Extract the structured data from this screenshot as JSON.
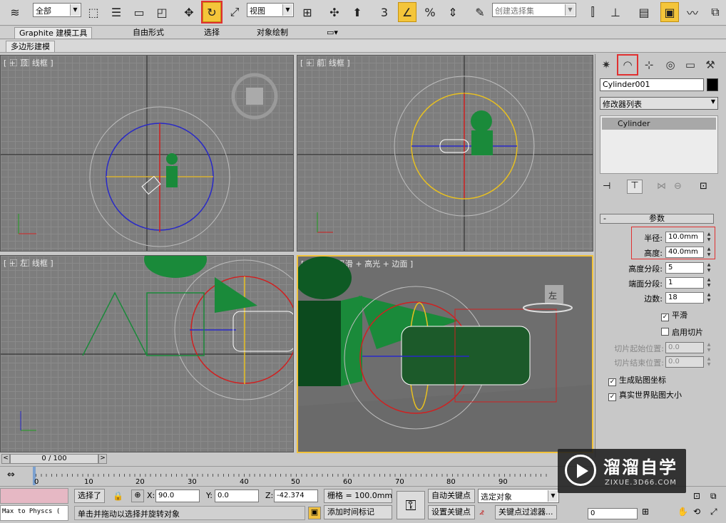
{
  "toolbar": {
    "selection_filter": "全部",
    "ref_coord": "视图",
    "named_selection_placeholder": "创建选择集",
    "snap_label": "3"
  },
  "ribbon": {
    "tabs": [
      "Graphite 建模工具",
      "自由形式",
      "选择",
      "对象绘制"
    ],
    "sub_tab": "多边形建模"
  },
  "viewports": {
    "top": {
      "label": "[ + ⃞ 顶 ⃞ 线框 ]"
    },
    "front": {
      "label": "[ + ⃞ 前 ⃞ 线框 ]"
    },
    "left": {
      "label": "[ + ⃞ 左 ⃞ 线框 ]"
    },
    "persp": {
      "label": "[ + ⃞ 透视 ⃞ 平滑 + 高光 + 边面 ]",
      "viewcube": "左"
    }
  },
  "command_panel": {
    "object_name": "Cylinder001",
    "modifier_list": "修改器列表",
    "stack_item": "Cylinder",
    "rollout_title": "参数",
    "params": [
      {
        "label": "半径:",
        "value": "10.0mm",
        "disabled": false
      },
      {
        "label": "高度:",
        "value": "40.0mm",
        "disabled": false
      },
      {
        "label": "高度分段:",
        "value": "5",
        "disabled": false
      },
      {
        "label": "端面分段:",
        "value": "1",
        "disabled": false
      },
      {
        "label": "边数:",
        "value": "18",
        "disabled": false
      }
    ],
    "smooth_label": "平滑",
    "smooth_checked": true,
    "slice_on_label": "启用切片",
    "slice_on_checked": false,
    "slice_from": {
      "label": "切片起始位置:",
      "value": "0.0"
    },
    "slice_to": {
      "label": "切片结束位置:",
      "value": "0.0"
    },
    "gen_map_label": "生成贴图坐标",
    "gen_map_checked": true,
    "real_world_label": "真实世界贴图大小",
    "real_world_checked": true
  },
  "timeline": {
    "frame_label": "0 / 100",
    "ticks": [
      "0",
      "10",
      "20",
      "30",
      "40",
      "50",
      "60",
      "70",
      "80",
      "90"
    ]
  },
  "status": {
    "maxscript": "Max to Physcs (",
    "selected": "选择了",
    "x_label": "X:",
    "x_value": "90.0",
    "y_label": "Y:",
    "y_value": "0.0",
    "z_label": "Z:",
    "z_value": "-42.374",
    "grid": "栅格 = 100.0mm",
    "auto_key": "自动关键点",
    "set_key": "设置关键点",
    "key_mode": "选定对象",
    "key_filter": "关键点过滤器...",
    "prompt": "单击并拖动以选择并旋转对象",
    "add_time_tag": "添加时间标记",
    "frame_value": "0"
  },
  "watermark": {
    "title": "溜溜自学",
    "url": "ZIXUE.3D66.COM"
  },
  "colors": {
    "active": "#f4c53a",
    "highlight_red": "#e03030",
    "object_green": "#1a8a3a"
  }
}
